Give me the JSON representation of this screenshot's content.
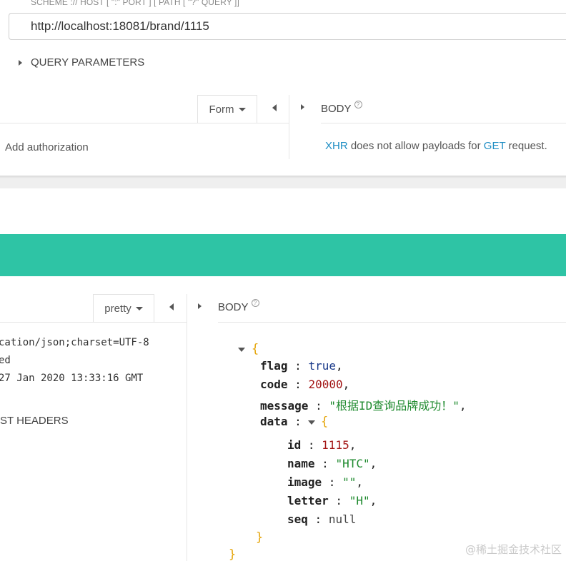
{
  "request": {
    "url_hint": "SCHEME :// HOST [ \":\" PORT ] [ PATH [ \"?\" QUERY ]]",
    "url": "http://localhost:18081/brand/1115",
    "query_parameters_label": "QUERY PARAMETERS",
    "auth_placeholder": "Add authorization",
    "format_dropdown": "Form",
    "body_label": "BODY",
    "help_glyph": "?",
    "body_message": {
      "xhr": "XHR",
      "middle": " does not allow payloads for ",
      "method": "GET",
      "end": " request."
    }
  },
  "response": {
    "format_dropdown": "pretty",
    "body_label": "BODY",
    "help_glyph": "?",
    "headers": [
      "cation/json;charset=UTF-8",
      "ed",
      "27 Jan 2020 13:33:16 GMT"
    ],
    "request_headers_label": "ST HEADERS",
    "json": {
      "open_brace": "{",
      "close_brace": "}",
      "flag_key": "flag",
      "flag_value": "true",
      "code_key": "code",
      "code_value": "20000",
      "message_key": "message",
      "message_value": "\"根据ID查询品牌成功！\"",
      "data_key": "data",
      "data": {
        "open_brace": "{",
        "close_brace": "}",
        "id_key": "id",
        "id_value": "1115",
        "name_key": "name",
        "name_value": "\"HTC\"",
        "image_key": "image",
        "image_value": "\"\"",
        "letter_key": "letter",
        "letter_value": "\"H\"",
        "seq_key": "seq",
        "seq_value": "null"
      }
    }
  },
  "colors": {
    "accent_bar": "#2ec4a5",
    "link": "#1f8ec4",
    "json_string": "#1e8a2e",
    "json_number": "#a31515",
    "json_bool": "#1a3a8a",
    "json_brace": "#e5a50a"
  },
  "watermark": "@稀土掘金技术社区"
}
